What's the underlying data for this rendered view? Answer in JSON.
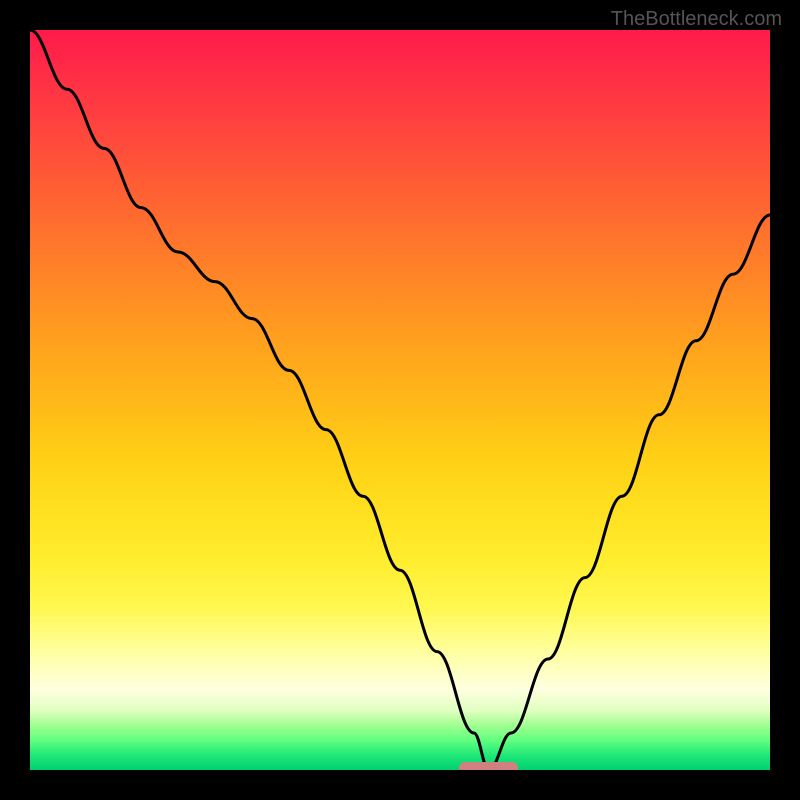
{
  "watermark": "TheBottleneck.com",
  "chart_data": {
    "type": "line",
    "title": "",
    "xlabel": "",
    "ylabel": "",
    "x": [
      0,
      5,
      10,
      15,
      20,
      25,
      30,
      35,
      40,
      45,
      50,
      55,
      60,
      62,
      65,
      70,
      75,
      80,
      85,
      90,
      95,
      100
    ],
    "values": [
      100,
      92,
      84,
      76,
      70,
      66,
      61,
      54,
      46,
      37,
      27,
      16,
      5,
      0,
      5,
      15,
      26,
      37,
      48,
      58,
      67,
      75
    ],
    "xlim": [
      0,
      100
    ],
    "ylim": [
      0,
      100
    ],
    "marker": {
      "x_start": 58,
      "x_end": 66,
      "y": 0,
      "color": "#d08080"
    },
    "background_gradient": [
      {
        "stop": 0,
        "color": "#ff1a4a"
      },
      {
        "stop": 50,
        "color": "#ffd015"
      },
      {
        "stop": 85,
        "color": "#ffffe0"
      },
      {
        "stop": 100,
        "color": "#00d070"
      }
    ]
  }
}
